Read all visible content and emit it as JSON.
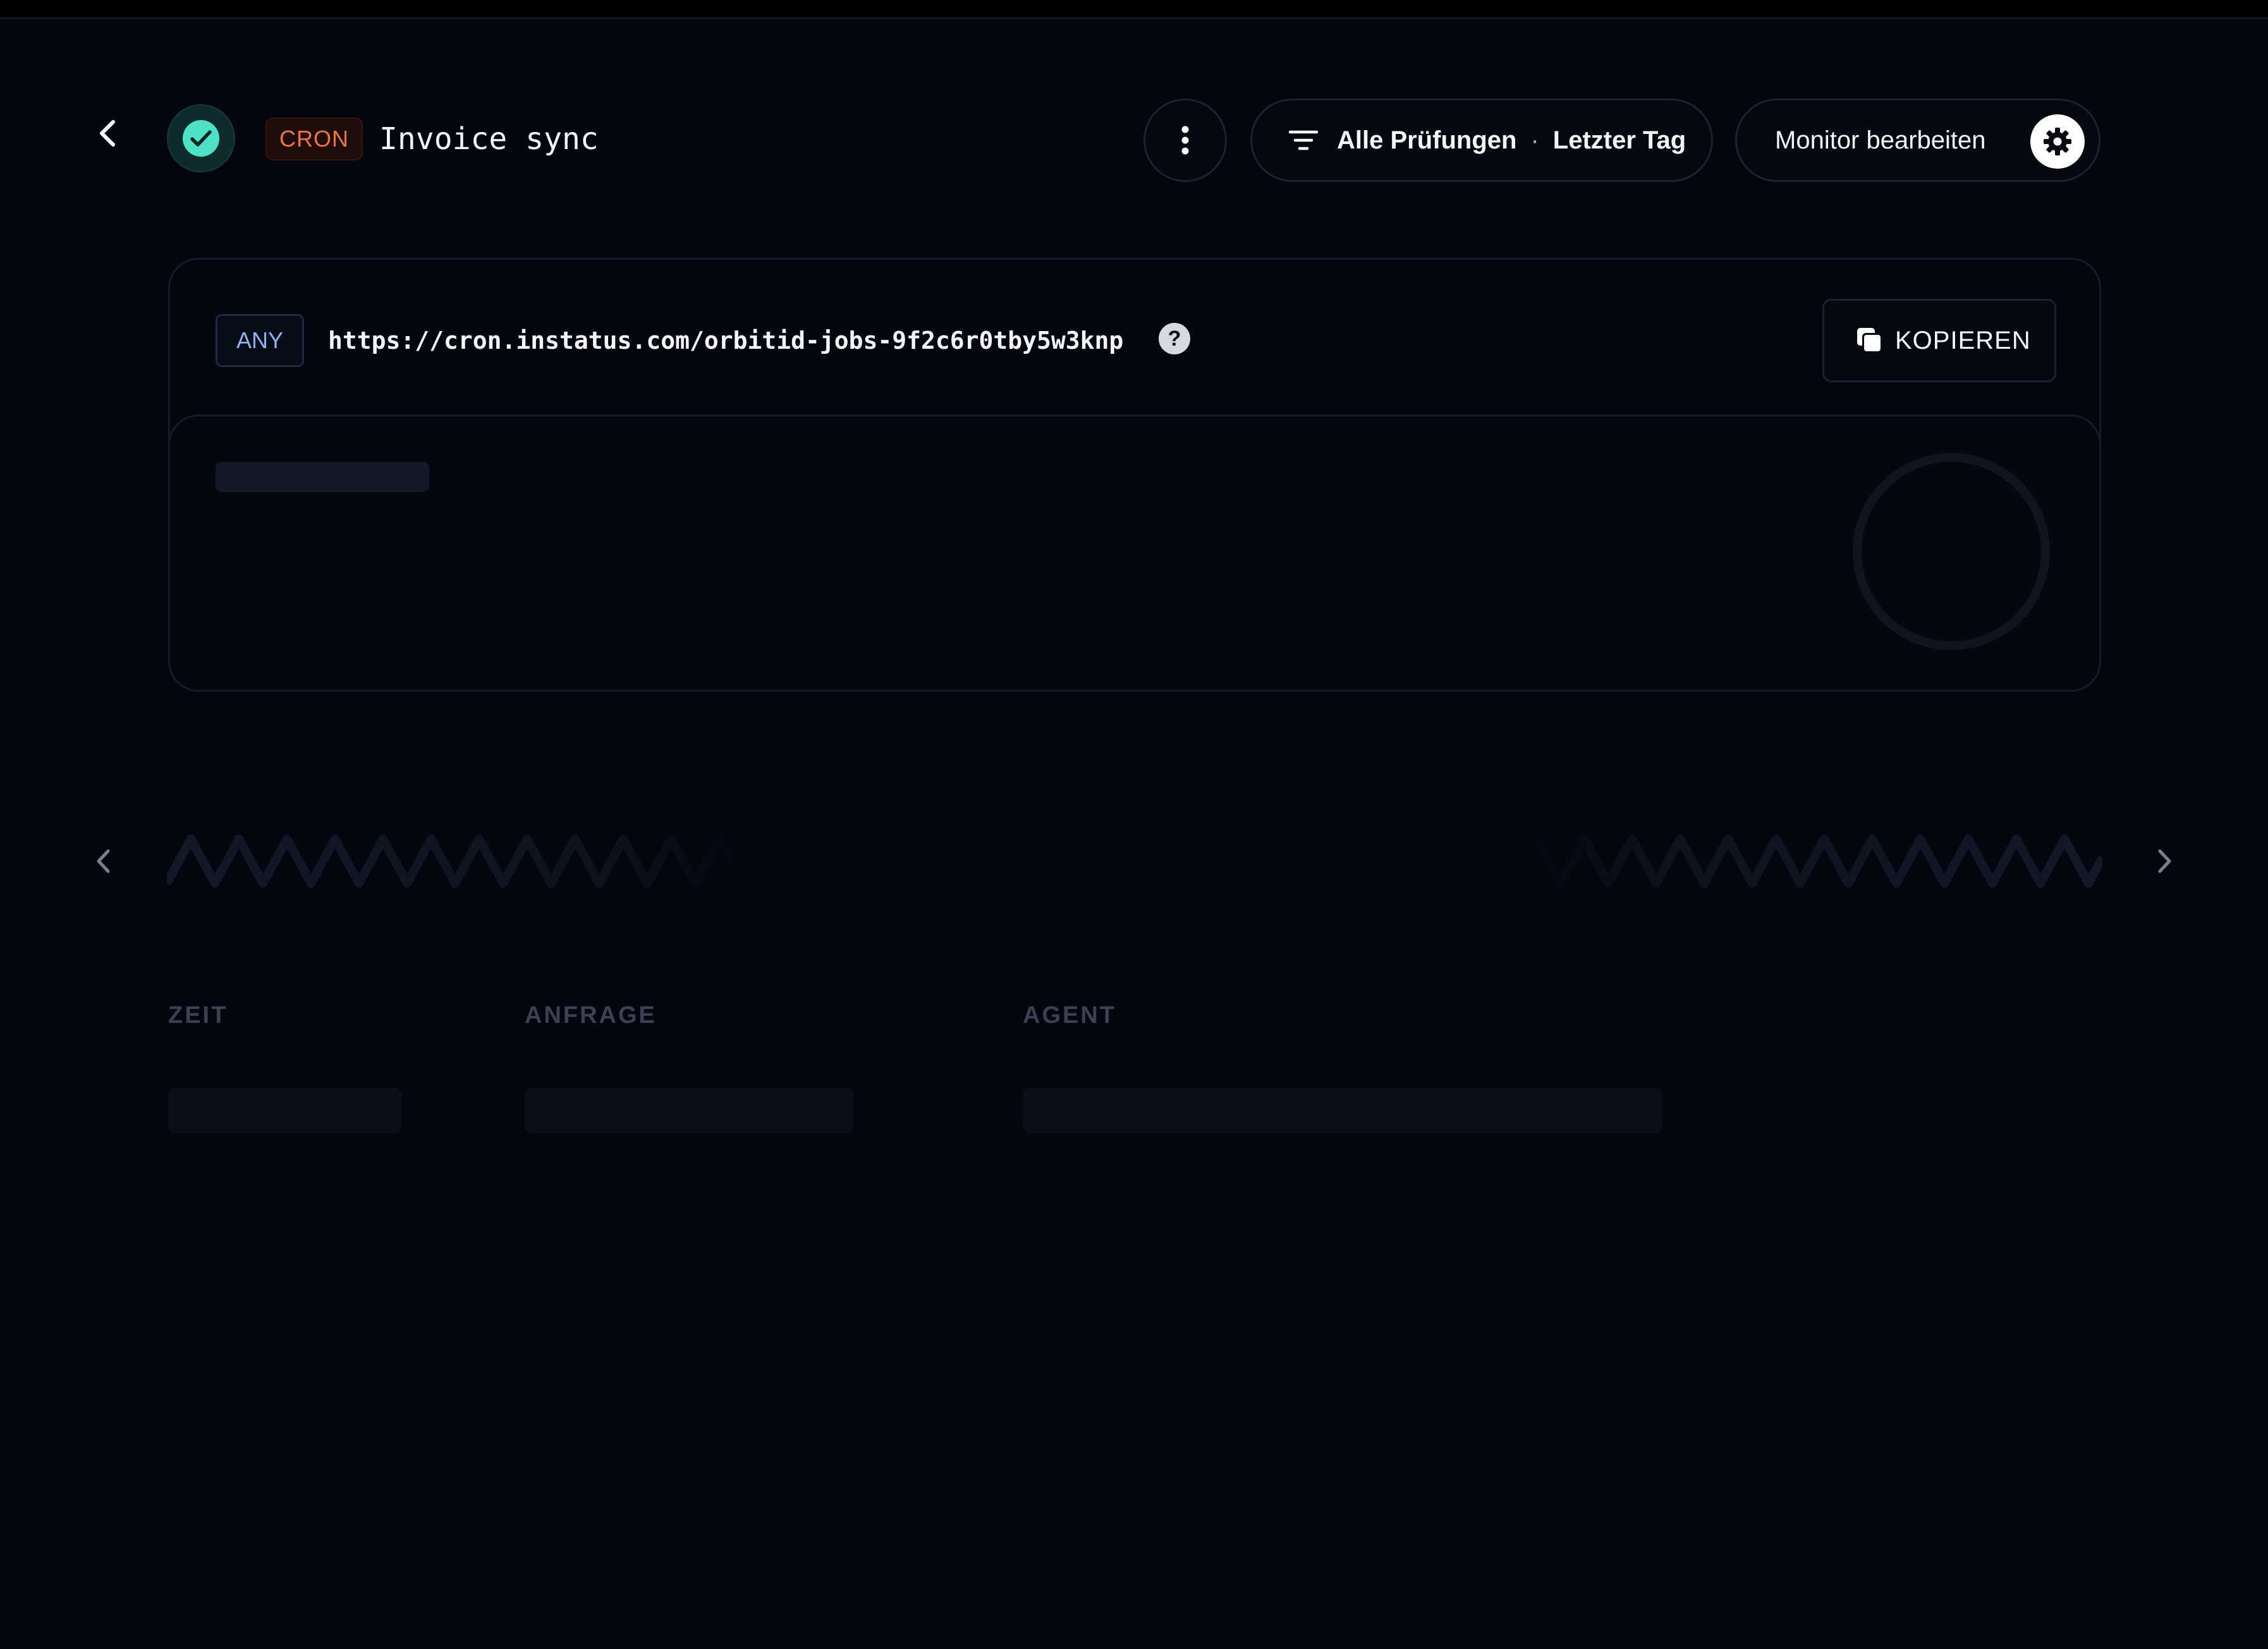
{
  "header": {
    "monitor_type": "CRON",
    "monitor_name": "Invoice sync",
    "filter": {
      "checks_label": "Alle Prüfungen",
      "separator": "·",
      "range_label": "Letzter Tag"
    },
    "edit_label": "Monitor bearbeiten"
  },
  "endpoint": {
    "method": "ANY",
    "url": "https://cron.instatus.com/orbitid-jobs-9f2c6r0tby5w3knp",
    "help_glyph": "?",
    "copy_label": "KOPIEREN"
  },
  "table": {
    "columns": [
      "ZEIT",
      "ANFRAGE",
      "AGENT"
    ]
  },
  "icons": {
    "back": "chevron-left-icon",
    "status": "check-circle-icon",
    "more": "vertical-dots-icon",
    "filter": "filter-lines-icon",
    "settings": "gear-icon",
    "copy": "copy-icon",
    "prev": "chevron-left-icon",
    "next": "chevron-right-icon"
  },
  "colors": {
    "background": "#03060f",
    "status_green": "#4be2c5",
    "cron_orange": "#f07345",
    "method_blue": "#8fb2ee"
  }
}
